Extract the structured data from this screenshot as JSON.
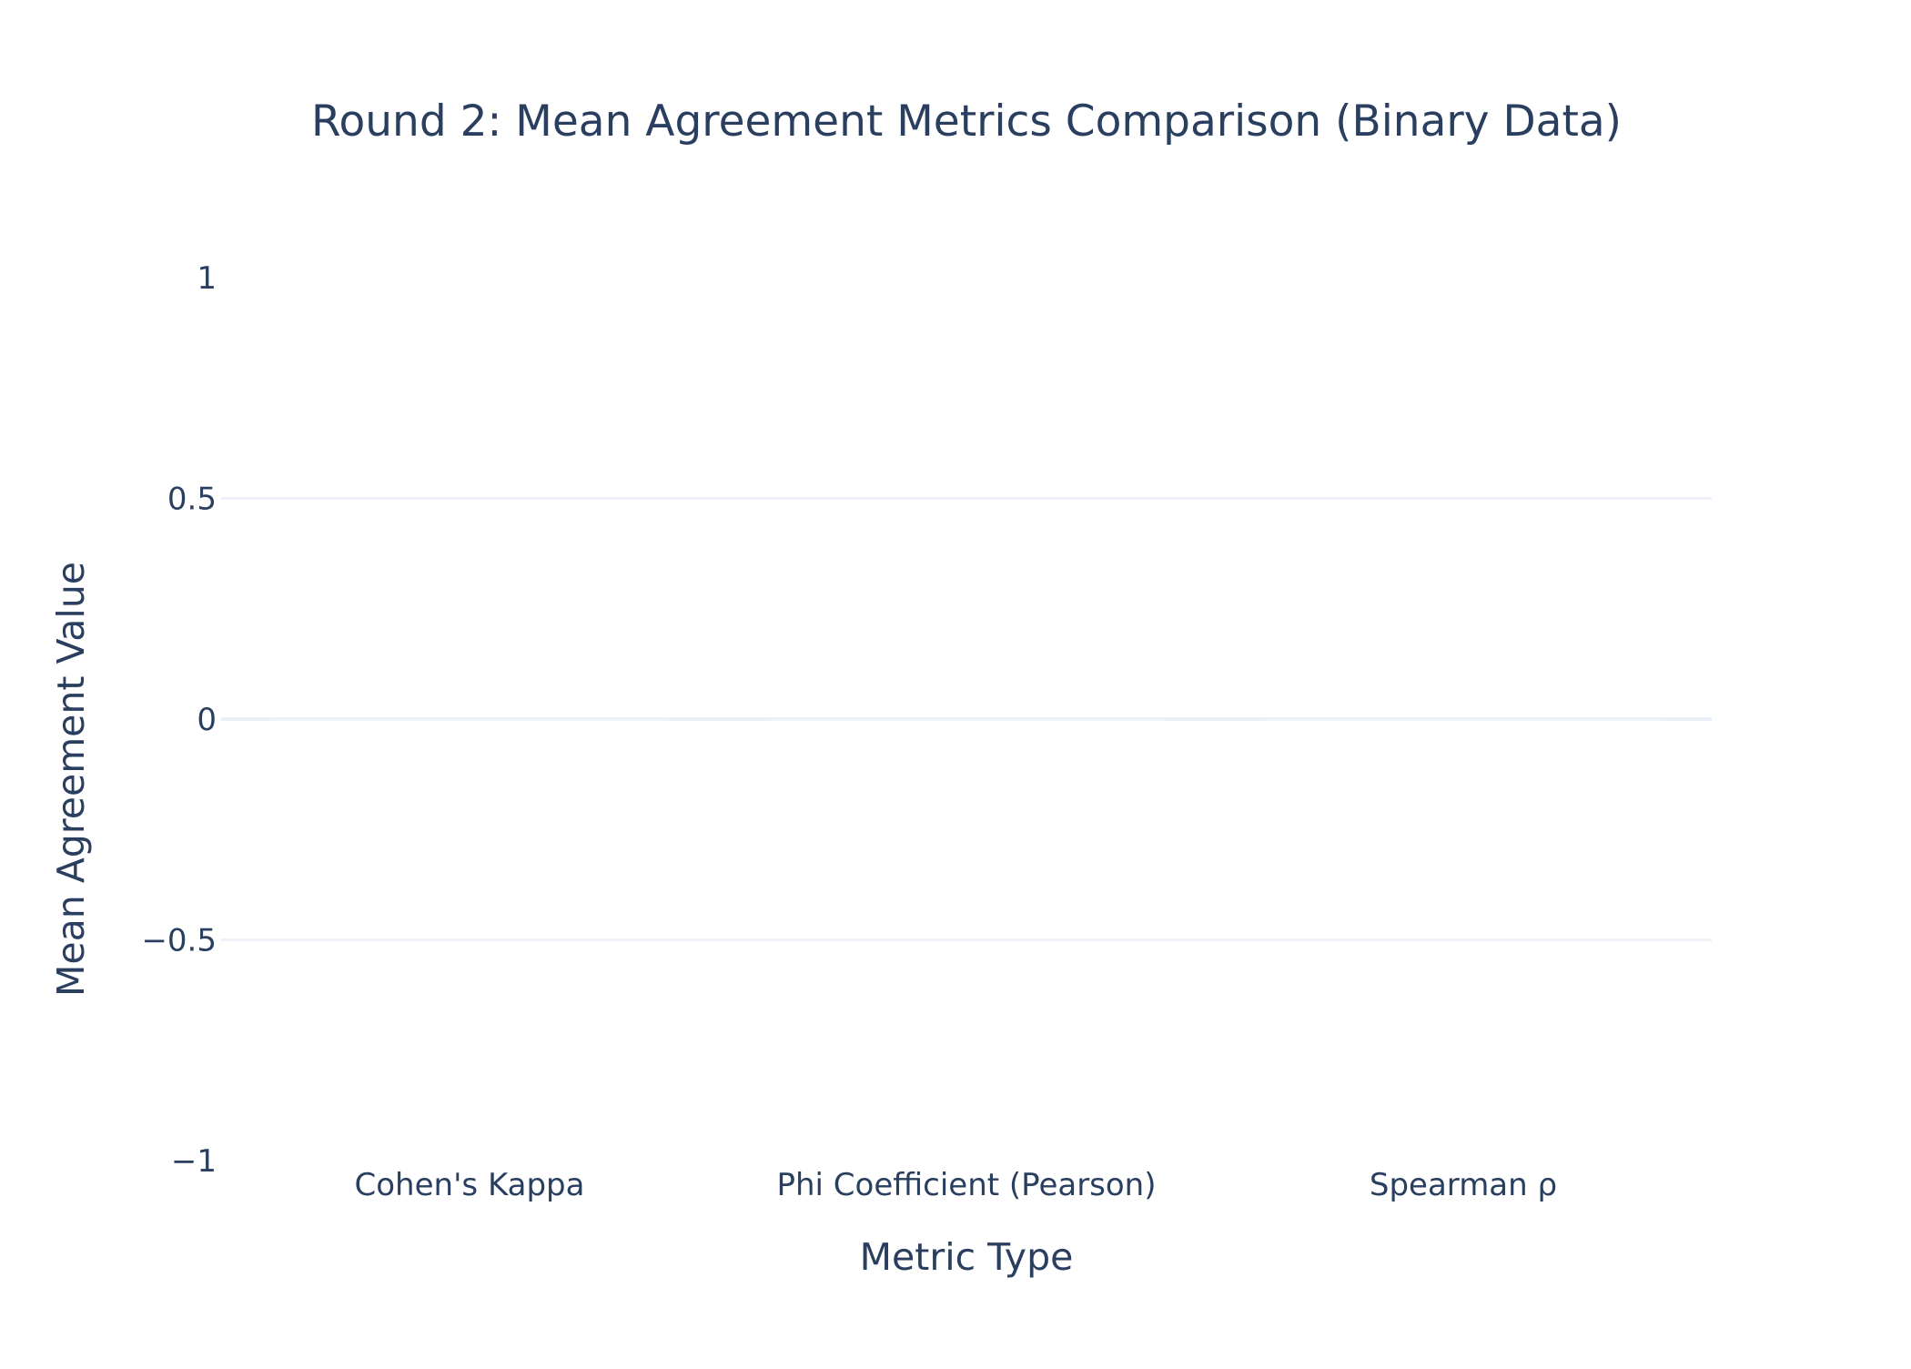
{
  "chart_data": {
    "type": "bar",
    "title": "Round 2: Mean Agreement Metrics Comparison (Binary Data)",
    "xlabel": "Metric Type",
    "ylabel": "Mean Agreement Value",
    "categories": [
      "Cohen's Kappa",
      "Phi Coefficient (Pearson)",
      "Spearman ρ"
    ],
    "values": [
      0,
      0,
      0
    ],
    "ylim": [
      -1,
      1
    ],
    "yticks": [
      -1,
      -0.5,
      0,
      0.5,
      1
    ],
    "ytick_labels": [
      "−1",
      "−0.5",
      "0",
      "0.5",
      "1"
    ],
    "grid": true,
    "legend": "none",
    "colors": {
      "text": "#2a3f5f",
      "grid": "#ebf0f8",
      "zeroline": "#ebf0f8",
      "background": "#ffffff"
    }
  }
}
